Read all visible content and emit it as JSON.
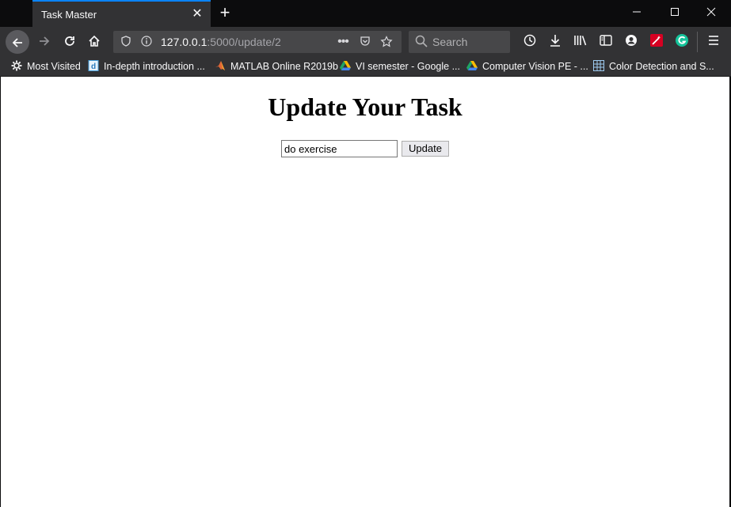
{
  "browser": {
    "tab": {
      "title": "Task Master"
    },
    "url": {
      "host": "127.0.0.1",
      "path": ":5000/update/2"
    },
    "search": {
      "placeholder": "Search"
    },
    "bookmarks": [
      {
        "label": "Most Visited",
        "icon": "gear-icon"
      },
      {
        "label": "In-depth introduction ...",
        "icon": "doc-icon"
      },
      {
        "label": "MATLAB Online R2019b",
        "icon": "matlab-icon"
      },
      {
        "label": "VI semester - Google ...",
        "icon": "drive-icon"
      },
      {
        "label": "Computer Vision PE - ...",
        "icon": "drive-icon"
      },
      {
        "label": "Color Detection and S...",
        "icon": "grid-icon"
      }
    ]
  },
  "page": {
    "heading": "Update Your Task",
    "form": {
      "task_value": "do exercise",
      "submit_label": "Update"
    }
  },
  "colors": {
    "tab_accent": "#0a84ff",
    "toolbar_bg": "#323234",
    "page_bg": "#ffffff"
  }
}
